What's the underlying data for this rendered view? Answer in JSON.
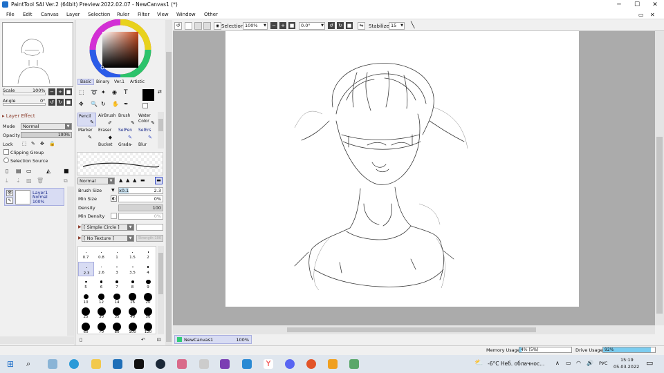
{
  "window": {
    "title": "PaintTool SAI Ver.2 (64bit) Preview.2022.02.07 - NewCanvas1 (*)",
    "minimize": "─",
    "maximize": "☐",
    "close": "✕"
  },
  "menu": [
    "File",
    "Edit",
    "Canvas",
    "Layer",
    "Selection",
    "Ruler",
    "Filter",
    "View",
    "Window",
    "Other"
  ],
  "navigator": {
    "scale_label": "Scale",
    "scale_value": "100%",
    "angle_label": "Angle",
    "angle_value": "0°"
  },
  "layer_effect": {
    "label": "Layer Effect"
  },
  "layer_props": {
    "mode_label": "Mode",
    "mode_value": "Normal",
    "opacity_label": "Opacity",
    "opacity_value": "100%",
    "opacity_fraction": 1.0,
    "lock_label": "Lock",
    "clipping_group": "Clipping Group",
    "selection_source": "Selection Source"
  },
  "layers": [
    {
      "name": "Layer1",
      "mode": "Normal",
      "opacity": "100%"
    }
  ],
  "color_tabs": [
    "Basic",
    "Binary",
    "Ver.1",
    "Artistic"
  ],
  "tools": [
    {
      "l1": "Pencil",
      "l2": ""
    },
    {
      "l1": "AirBrush",
      "l2": ""
    },
    {
      "l1": "Brush",
      "l2": ""
    },
    {
      "l1": "Water",
      "l2": "Color"
    },
    {
      "l1": "Marker",
      "l2": ""
    },
    {
      "l1": "Eraser",
      "l2": ""
    },
    {
      "l1": "SelPen",
      "l2": ""
    },
    {
      "l1": "SelErs",
      "l2": ""
    },
    {
      "l1": "",
      "l2": "Bucket"
    },
    {
      "l1": "",
      "l2": "Grada-"
    },
    {
      "l1": "",
      "l2": "Blur"
    }
  ],
  "brush": {
    "mode": "Normal",
    "size_label": "Brush Size",
    "size_mult": "x0.1",
    "size_value": "2.3",
    "min_size_label": "Min Size",
    "min_size_value": "0%",
    "density_label": "Density",
    "density_value": "100",
    "min_density_label": "Min Density",
    "min_density_value": "0%",
    "shape": "[ Simple Circle ]",
    "texture": "[ No Texture ]",
    "texture_strength": "Strength",
    "texture_value": "100"
  },
  "brush_sizes": [
    "0.7",
    "0.8",
    "1",
    "1.5",
    "2",
    "2.3",
    "2.6",
    "3",
    "3.5",
    "4",
    "5",
    "6",
    "7",
    "8",
    "9",
    "10",
    "12",
    "14",
    "16",
    "20",
    "25",
    "30",
    "35",
    "40",
    "50",
    "60",
    "70",
    "80",
    "100",
    "120"
  ],
  "canvas_toolbar": {
    "selection_label": "Selection",
    "zoom": "100%",
    "angle": "0.0°",
    "stabilizer_label": "Stabilizer",
    "stabilizer_value": "15"
  },
  "canvas_tab": {
    "name": "NewCanvas1",
    "zoom": "100%"
  },
  "status": {
    "memory_label": "Memory Usage",
    "memory_value": "4% (5%)",
    "memory_fraction": 0.04,
    "drive_label": "Drive Usage",
    "drive_value": "92%",
    "drive_fraction": 0.92
  },
  "taskbar": {
    "weather": "-6°C  Неб. облачнос...",
    "lang": "РУС",
    "time": "15:19",
    "date": "05.03.2022"
  },
  "colors": {
    "accent": "#1e6fc9",
    "selection": "#d8dcf3",
    "fg_color": "#000000",
    "canvas_bg": "#ababab"
  }
}
